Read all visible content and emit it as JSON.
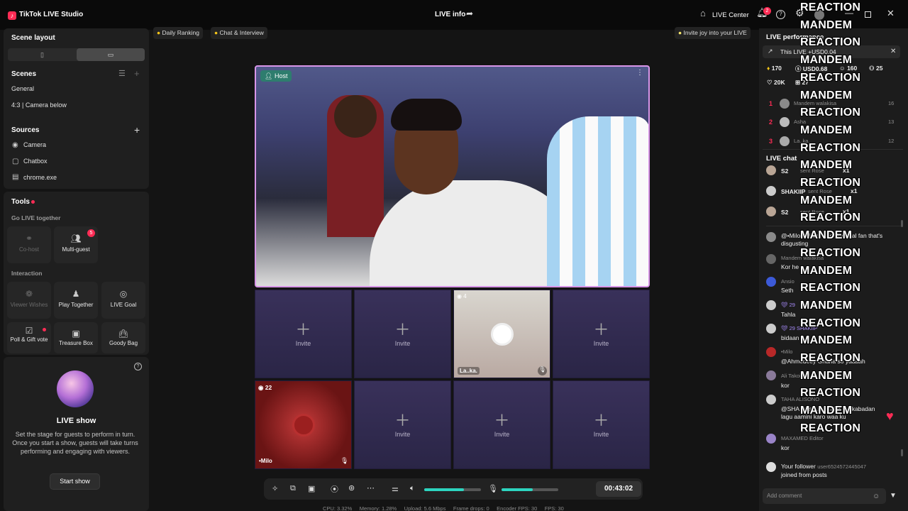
{
  "app": {
    "title": "TikTok LIVE Studio",
    "live_info": "LIVE info",
    "live_center": "LIVE Center",
    "notif_count": "2"
  },
  "left": {
    "scene_layout": "Scene layout",
    "scenes_title": "Scenes",
    "scenes": [
      "General",
      "4:3 | Camera below"
    ],
    "sources_title": "Sources",
    "sources": [
      "Camera",
      "Chatbox",
      "chrome.exe"
    ],
    "tools_title": "Tools",
    "go_live_together": "Go LIVE together",
    "cohost": "Co-host",
    "multiguest": "Multi-guest",
    "multiguest_badge": "5",
    "interaction": "Interaction",
    "viewer_wishes": "Viewer Wishes",
    "play_together": "Play Together",
    "live_goal": "LIVE Goal",
    "poll": "Poll & Gift vote",
    "treasure": "Treasure Box",
    "goody": "Goody Bag",
    "live_show_title": "LIVE show",
    "live_show_desc": "Set the stage for guests to perform in turn. Once you start a show, guests will take turns performing and engaging with viewers.",
    "start_show": "Start show"
  },
  "chips": {
    "daily_ranking": "Daily Ranking",
    "chat_interview": "Chat & Interview",
    "invite_joy": "Invite joy into your LIVE"
  },
  "stage": {
    "host_label": "Host",
    "invite": "Invite",
    "guest1_name": "La..ka.",
    "guest1_count": "4",
    "guest2_name": "•Milo",
    "guest2_count": "22"
  },
  "controls": {
    "timer": "00:43:02",
    "volume_level": 0.7,
    "mic_level": 0.55
  },
  "stats": {
    "cpu": "CPU: 3.32%",
    "memory": "Memory: 1.28%",
    "upload": "Upload: 5.6 Mbps",
    "frame_drops": "Frame drops: 0",
    "encoder_fps": "Encoder FPS: 30",
    "fps": "FPS: 30"
  },
  "right": {
    "perf_title": "LIVE performance",
    "this_live": "This LIVE +USD0.04",
    "diamonds": "170",
    "usd": "USD0.68",
    "viewers": "160",
    "gifters": "25",
    "likes": "20K",
    "shares": "27",
    "ranking": [
      {
        "rank": "1",
        "name": "Mandem walakisa",
        "score": "16"
      },
      {
        "rank": "2",
        "name": "Asha",
        "score": "13"
      },
      {
        "rank": "3",
        "name": "La..ka.",
        "score": "12"
      }
    ],
    "chat_title": "LIVE chat",
    "gifts": [
      {
        "name": "S2",
        "action": "sent Rose",
        "count": "x1"
      },
      {
        "name": "SHAKIIP",
        "action": "sent Rose",
        "count": "x1"
      },
      {
        "name": "S2",
        "action": "sent Rose",
        "count": "x1"
      }
    ],
    "messages": [
      {
        "name": "@•Milo",
        "text": "@•Milo willhi united and real fan that's disgusting"
      },
      {
        "name": "Mandem walakisa",
        "text": "Kor he"
      },
      {
        "name": "Ansio",
        "text": "Seth"
      },
      {
        "name": "29",
        "text": "Tahla"
      },
      {
        "name": "SHAKIIP",
        "text": "bidaan"
      },
      {
        "name": "•Milo",
        "text": "@Ahmedeey Ghana so yaaaah"
      },
      {
        "name": "Ali Takoi",
        "text": "kor"
      },
      {
        "name": "TAHA ALISONO",
        "text": "@SHA masuul ah afar iyo kabadan lagu aamini karo waa ku"
      },
      {
        "name": "MAXAMED Editor",
        "text": "kor"
      }
    ],
    "follower_line": "Your follower",
    "follower_user": "user6524572445047",
    "follower_joined": "joined from posts",
    "add_comment": "Add comment"
  },
  "overlay": {
    "words": [
      "REACTION",
      "MANDEM",
      "REACTION",
      "MANDEM",
      "REACTION",
      "MANDEM",
      "REACTION",
      "MANDEM",
      "REACTION",
      "MANDEM",
      "REACTION",
      "MANDEM",
      "REACTION",
      "MANDEM",
      "REACTION",
      "MANDEM",
      "REACTION",
      "MANDEM",
      "REACTION",
      "MANDEM",
      "REACTION",
      "MANDEM",
      "REACTION",
      "MANDEM",
      "REACTION"
    ]
  }
}
